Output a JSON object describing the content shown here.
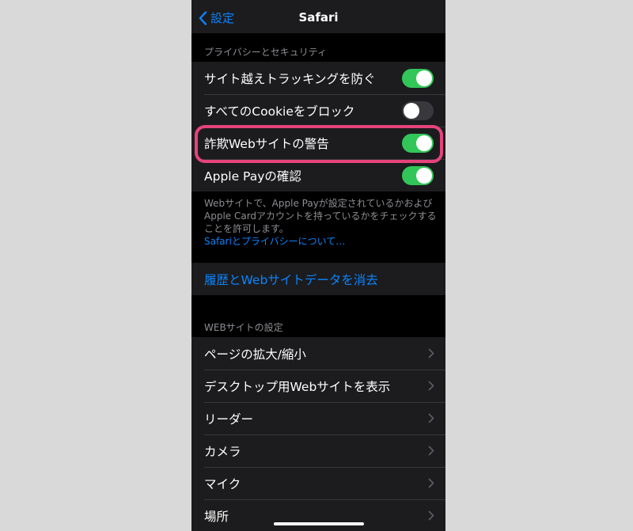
{
  "navbar": {
    "back_label": "設定",
    "title": "Safari"
  },
  "privacy": {
    "header": "プライバシーとセキュリティ",
    "rows": [
      {
        "label": "サイト越えトラッキングを防ぐ",
        "toggle": "on"
      },
      {
        "label": "すべてのCookieをブロック",
        "toggle": "off"
      },
      {
        "label": "詐欺Webサイトの警告",
        "toggle": "on"
      },
      {
        "label": "Apple Payの確認",
        "toggle": "on"
      }
    ],
    "footer": "Webサイトで、Apple Payが設定されているかおよびApple Cardアカウントを持っているかをチェックすることを許可します。",
    "footer_link": "Safariとプライバシーについて…"
  },
  "clear_history": {
    "label": "履歴とWebサイトデータを消去"
  },
  "website_settings": {
    "header": "WEBサイトの設定",
    "rows": [
      {
        "label": "ページの拡大/縮小"
      },
      {
        "label": "デスクトップ用Webサイトを表示"
      },
      {
        "label": "リーダー"
      },
      {
        "label": "カメラ"
      },
      {
        "label": "マイク"
      },
      {
        "label": "場所"
      }
    ]
  },
  "colors": {
    "accent": "#0a84ff",
    "toggle_on": "#32c659",
    "highlight": "#e5447a",
    "background": "#000000",
    "cell": "#1c1c1e"
  }
}
